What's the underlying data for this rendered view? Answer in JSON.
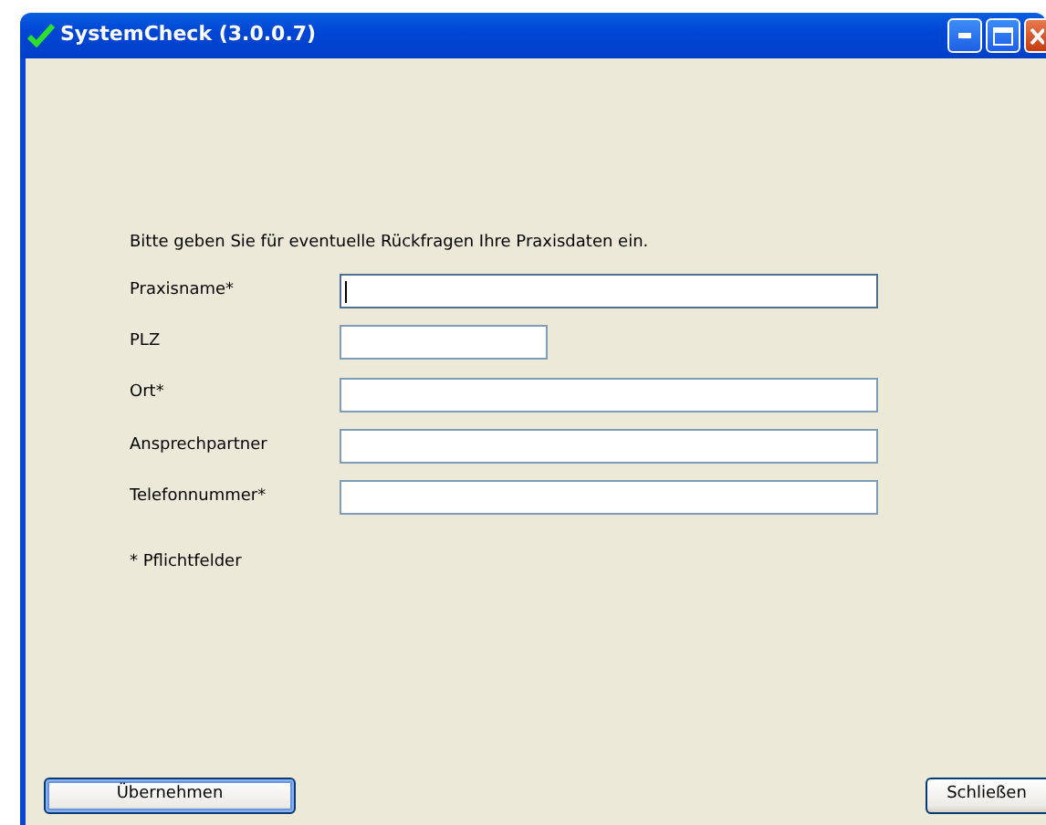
{
  "window": {
    "title": "SystemCheck (3.0.0.7)"
  },
  "intro": "Bitte geben Sie für eventuelle Rückfragen Ihre Praxisdaten ein.",
  "fields": [
    {
      "label": "Praxisname*",
      "kind": "wide",
      "focused": true
    },
    {
      "label": "PLZ",
      "kind": "short",
      "focused": false
    },
    {
      "label": "Ort*",
      "kind": "wide",
      "focused": false
    },
    {
      "label": "Ansprechpartner",
      "kind": "wide",
      "focused": false
    },
    {
      "label": "Telefonnummer*",
      "kind": "wide",
      "focused": false
    }
  ],
  "note": "* Pflichtfelder",
  "buttons": [
    {
      "label": "Übernehmen",
      "kind": "default"
    },
    {
      "label": "Schließen",
      "kind": "normal"
    }
  ]
}
